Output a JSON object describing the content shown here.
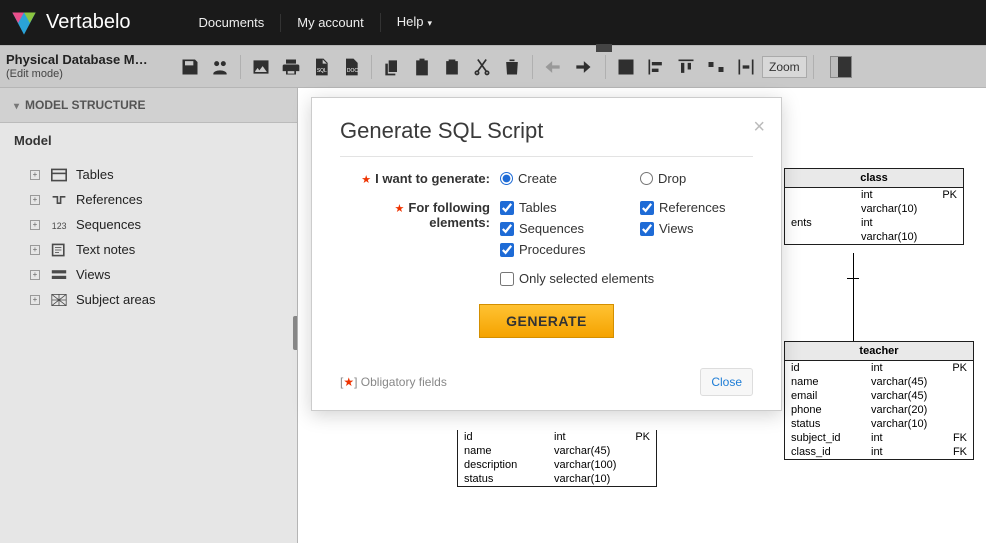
{
  "header": {
    "brand": "Vertabelo",
    "nav": [
      "Documents",
      "My account",
      "Help"
    ]
  },
  "doc": {
    "title": "Physical Database M…",
    "mode": "(Edit mode)",
    "zoom": "Zoom"
  },
  "sidebar": {
    "title": "MODEL STRUCTURE",
    "root": "Model",
    "items": [
      {
        "label": "Tables"
      },
      {
        "label": "References"
      },
      {
        "label": "Sequences"
      },
      {
        "label": "Text notes"
      },
      {
        "label": "Views"
      },
      {
        "label": "Subject areas"
      }
    ]
  },
  "modal": {
    "title": "Generate SQL Script",
    "label_generate": "I want to generate:",
    "label_elements": "For following elements:",
    "radio_create": "Create",
    "radio_drop": "Drop",
    "chk_tables": "Tables",
    "chk_references": "References",
    "chk_sequences": "Sequences",
    "chk_views": "Views",
    "chk_procedures": "Procedures",
    "chk_selected": "Only selected elements",
    "btn": "GENERATE",
    "oblig": "Obligatory fields",
    "close": "Close"
  },
  "tables": {
    "class": {
      "name": "class",
      "rows": [
        {
          "c1": "",
          "c2": "int",
          "c3": "PK"
        },
        {
          "c1": "",
          "c2": "varchar(10)",
          "c3": ""
        },
        {
          "c1": "ents",
          "c2": "int",
          "c3": ""
        },
        {
          "c1": "",
          "c2": "varchar(10)",
          "c3": ""
        }
      ]
    },
    "teacher": {
      "name": "teacher",
      "rows": [
        {
          "c1": "id",
          "c2": "int",
          "c3": "PK"
        },
        {
          "c1": "name",
          "c2": "varchar(45)",
          "c3": ""
        },
        {
          "c1": "email",
          "c2": "varchar(45)",
          "c3": ""
        },
        {
          "c1": "phone",
          "c2": "varchar(20)",
          "c3": ""
        },
        {
          "c1": "status",
          "c2": "varchar(10)",
          "c3": ""
        },
        {
          "c1": "subject_id",
          "c2": "int",
          "c3": "FK"
        },
        {
          "c1": "class_id",
          "c2": "int",
          "c3": "FK"
        }
      ]
    },
    "subject": {
      "name": "",
      "rows": [
        {
          "c1": "id",
          "c2": "int",
          "c3": "PK"
        },
        {
          "c1": "name",
          "c2": "varchar(45)",
          "c3": ""
        },
        {
          "c1": "description",
          "c2": "varchar(100)",
          "c3": ""
        },
        {
          "c1": "status",
          "c2": "varchar(10)",
          "c3": ""
        }
      ]
    }
  }
}
